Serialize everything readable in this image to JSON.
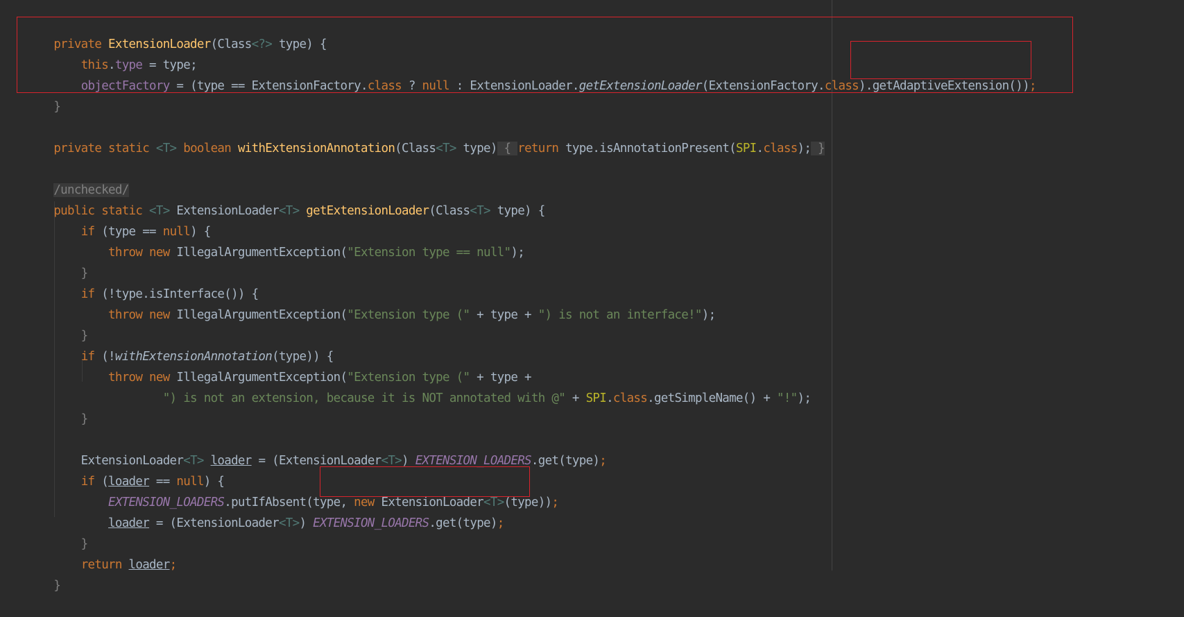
{
  "editor": {
    "lines": {
      "l1": {
        "t1": "private ",
        "t2": "ExtensionLoader",
        "t3": "(Class",
        "t4": "<?>",
        "t5": " type) {"
      },
      "l2": {
        "t1": "    ",
        "t2": "this",
        "t3": ".",
        "t4": "type",
        "t5": " = type;"
      },
      "l3": {
        "t1": "    ",
        "t2": "objectFactory",
        "t3": " = (type == ExtensionFactory.",
        "t4": "class",
        "t5": " ? ",
        "t6": "null",
        "t7": " : ExtensionLoader.",
        "t8": "getExtensionLoader",
        "t9": "(ExtensionFactory.",
        "t10": "class",
        "t11": ").getAdaptiveExtension())",
        "t12": ";"
      },
      "l4": {
        "t1": "}"
      },
      "l5": {
        "t1": "private static ",
        "t2": "<T>",
        "t3": " ",
        "t4": "boolean ",
        "t5": "withExtensionAnnotation",
        "t6": "(Class",
        "t7": "<T>",
        "t8": " type)",
        "t9": " { ",
        "t10": "return ",
        "t11": "type.isAnnotationPresent(",
        "t12": "SPI",
        "t13": ".",
        "t14": "class",
        "t15": ");",
        "t16": " }"
      },
      "l6": {
        "t1": "/unchecked/"
      },
      "l7": {
        "t1": "public static ",
        "t2": "<T>",
        "t3": " ExtensionLoader",
        "t4": "<T>",
        "t5": " ",
        "t6": "getExtensionLoader",
        "t7": "(Class",
        "t8": "<T>",
        "t9": " type) {"
      },
      "l8": {
        "t1": "    ",
        "t2": "if ",
        "t3": "(type == ",
        "t4": "null",
        "t5": ") {"
      },
      "l9": {
        "t1": "        ",
        "t2": "throw new ",
        "t3": "IllegalArgumentException(",
        "t4": "\"Extension type == null\"",
        "t5": ");"
      },
      "l10": {
        "t1": "    }"
      },
      "l11": {
        "t1": "    ",
        "t2": "if ",
        "t3": "(!type.isInterface()) {"
      },
      "l12": {
        "t1": "        ",
        "t2": "throw new ",
        "t3": "IllegalArgumentException(",
        "t4": "\"Extension type (\"",
        "t5": " + type + ",
        "t6": "\") is not an interface!\"",
        "t7": ");"
      },
      "l13": {
        "t1": "    }"
      },
      "l14": {
        "t1": "    ",
        "t2": "if ",
        "t3": "(!",
        "t4": "withExtensionAnnotation",
        "t5": "(type)) {"
      },
      "l15": {
        "t1": "        ",
        "t2": "throw new ",
        "t3": "IllegalArgumentException(",
        "t4": "\"Extension type (\"",
        "t5": " + type +"
      },
      "l16": {
        "t1": "                ",
        "t2": "\") is not an extension, because it is NOT annotated with @\"",
        "t3": " + ",
        "t4": "SPI",
        "t5": ".",
        "t6": "class",
        "t7": ".getSimpleName() + ",
        "t8": "\"!\"",
        "t9": ");"
      },
      "l17": {
        "t1": "    }"
      },
      "l18": {
        "t1": "    ExtensionLoader",
        "t2": "<T>",
        "t3": " ",
        "t4": "loader",
        "t5": " = (ExtensionLoader",
        "t6": "<T>",
        "t7": ") ",
        "t8": "EXTENSION_LOADERS",
        "t9": ".get(type)",
        "t10": ";"
      },
      "l19": {
        "t1": "    ",
        "t2": "if ",
        "t3": "(",
        "t4": "loader",
        "t5": " == ",
        "t6": "null",
        "t7": ") {"
      },
      "l20": {
        "t1": "        ",
        "t2": "EXTENSION_LOADERS",
        "t3": ".putIfAbsent(type, ",
        "t4": "new ",
        "t5": "ExtensionLoader",
        "t6": "<T>",
        "t7": "(type))",
        "t8": ";"
      },
      "l21": {
        "t1": "        ",
        "t2": "loader",
        "t3": " = (ExtensionLoader",
        "t4": "<T>",
        "t5": ") ",
        "t6": "EXTENSION_LOADERS",
        "t7": ".get(type)",
        "t8": ";"
      },
      "l22": {
        "t1": "    }"
      },
      "l23": {
        "t1": "    ",
        "t2": "return ",
        "t3": "loader",
        "t4": ";"
      },
      "l24": {
        "t1": "}"
      }
    },
    "colors": {
      "background": "#2b2b2b",
      "text": "#a9b7c6",
      "keyword": "#cc7832",
      "method": "#ffc66d",
      "field": "#9876aa",
      "string": "#6a8759",
      "type-param": "#507874",
      "annotation": "#bbb529",
      "highlight-box": "#d9232c"
    }
  }
}
